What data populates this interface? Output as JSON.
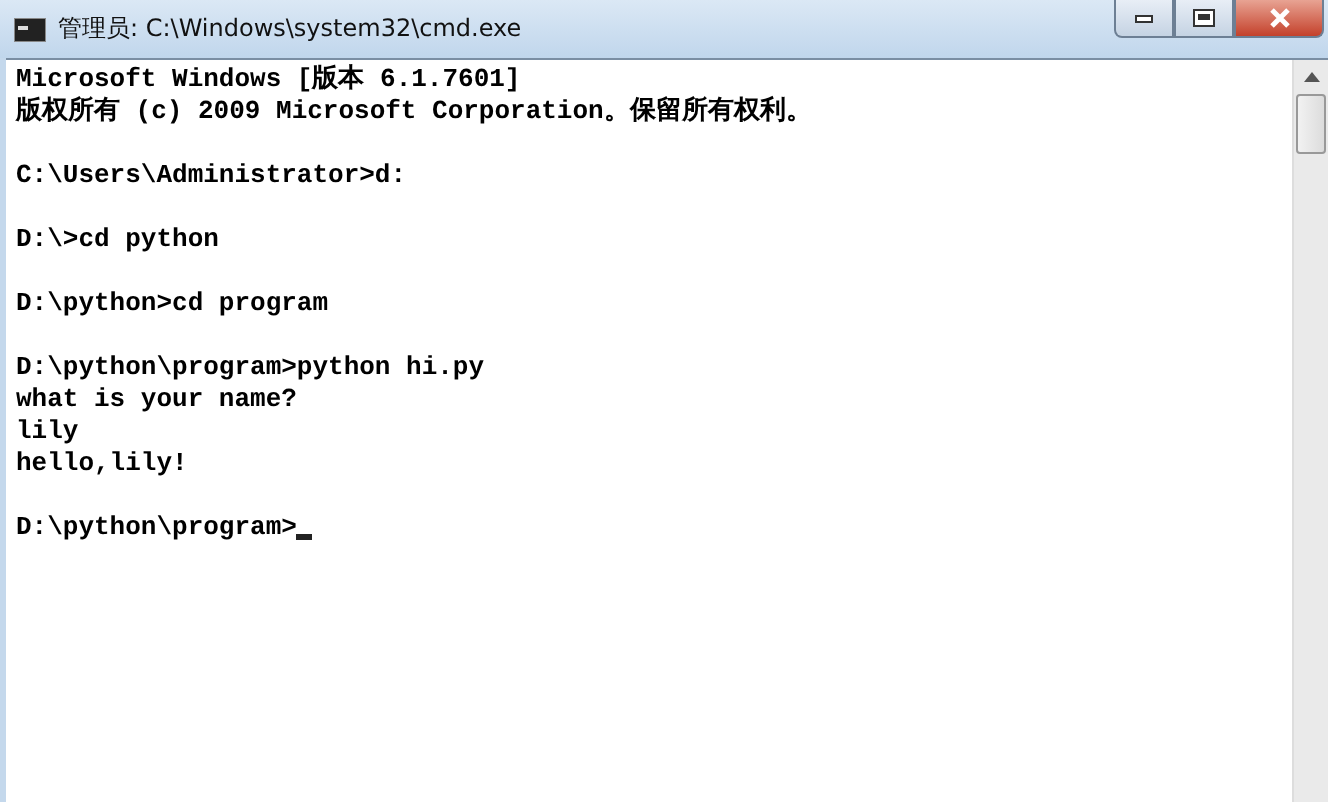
{
  "window": {
    "title": "管理员: C:\\Windows\\system32\\cmd.exe"
  },
  "console": {
    "blocks": [
      [
        "Microsoft Windows [版本 6.1.7601]",
        "版权所有 (c) 2009 Microsoft Corporation。保留所有权利。"
      ],
      [
        "C:\\Users\\Administrator>d:"
      ],
      [
        "D:\\>cd python"
      ],
      [
        "D:\\python>cd program"
      ],
      [
        "D:\\python\\program>python hi.py",
        "what is your name?",
        "lily",
        "hello,lily!"
      ],
      [
        "D:\\python\\program>"
      ]
    ],
    "cursor": true
  }
}
